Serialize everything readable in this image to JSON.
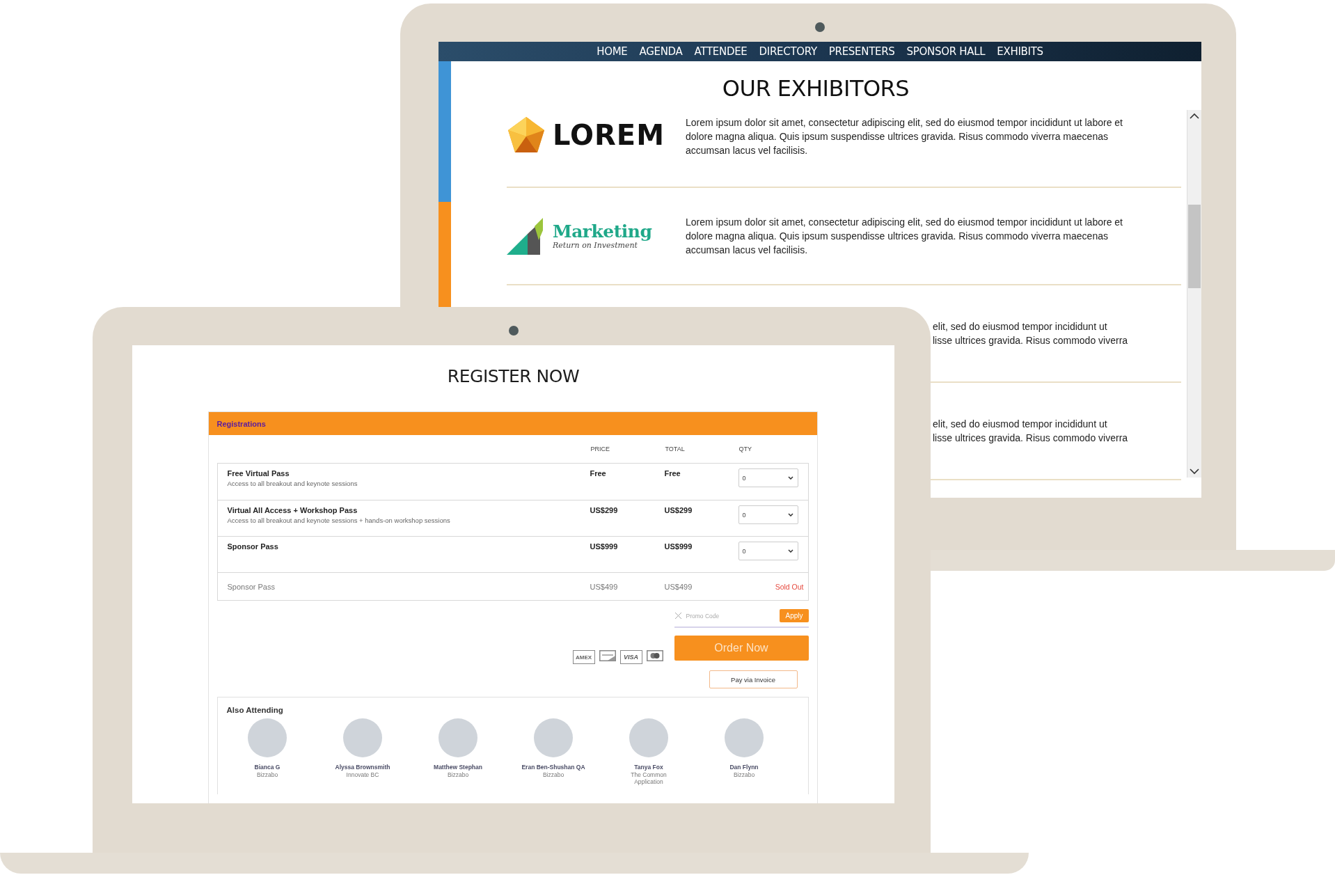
{
  "exhibits_screen": {
    "nav": [
      "HOME",
      "AGENDA",
      "ATTENDEE",
      "DIRECTORY",
      "PRESENTERS",
      "SPONSOR HALL",
      "EXHIBITS"
    ],
    "title": "OUR EXHIBITORS",
    "exhibitors": [
      {
        "kind": "full",
        "logo": {
          "kind": "pentagon",
          "title": "LOREM"
        },
        "description": "Lorem ipsum dolor sit amet, consectetur adipiscing elit, sed do eiusmod tempor incididunt ut labore et dolore magna aliqua. Quis ipsum suspendisse ultrices gravida. Risus commodo viverra maecenas accumsan lacus vel facilisis."
      },
      {
        "kind": "full",
        "logo": {
          "kind": "chart",
          "title": "Marketing",
          "subtitle": "Return on Investment"
        },
        "description": "Lorem ipsum dolor sit amet, consectetur adipiscing elit, sed do eiusmod tempor incididunt ut labore et dolore magna aliqua. Quis ipsum suspendisse ultrices gravida. Risus commodo viverra maecenas accumsan lacus vel facilisis."
      },
      {
        "kind": "partial",
        "lines": [
          "elit, sed do eiusmod tempor incididunt ut",
          "lisse ultrices gravida. Risus commodo viverra"
        ]
      },
      {
        "kind": "partial",
        "lines": [
          "elit, sed do eiusmod tempor incididunt ut",
          "lisse ultrices gravida. Risus commodo viverra"
        ]
      }
    ]
  },
  "register_screen": {
    "title": "REGISTER NOW",
    "panel_title": "Registrations",
    "columns": [
      "PRICE",
      "TOTAL",
      "QTY"
    ],
    "tickets": [
      {
        "kind": "available",
        "name": "Free Virtual Pass",
        "description": "Access to all breakout and keynote sessions",
        "price": "Free",
        "total": "Free",
        "qty": "0"
      },
      {
        "kind": "available",
        "name": "Virtual All Access + Workshop Pass",
        "description": "Access to all breakout and keynote sessions + hands-on workshop sessions",
        "price": "US$299",
        "total": "US$299",
        "qty": "0"
      },
      {
        "kind": "available",
        "name": "Sponsor Pass",
        "price": "US$999",
        "total": "US$999",
        "qty": "0"
      },
      {
        "kind": "sold_out",
        "name": "Sponsor Pass",
        "price": "US$499",
        "total": "US$499",
        "status": "Sold Out"
      }
    ],
    "promo": {
      "placeholder": "Promo Code",
      "apply": "Apply"
    },
    "cards": [
      {
        "kind": "amex",
        "label": "AMEX"
      },
      {
        "kind": "discover"
      },
      {
        "kind": "visa",
        "label": "VISA"
      },
      {
        "kind": "mastercard"
      }
    ],
    "order_button": "Order Now",
    "invoice_button": "Pay via Invoice",
    "attending": {
      "title": "Also Attending",
      "people": [
        {
          "name": "Bianca G",
          "company": "Bizzabo"
        },
        {
          "name": "Alyssa Brownsmith",
          "company": "Innovate BC"
        },
        {
          "name": "Matthew Stephan",
          "company": "Bizzabo"
        },
        {
          "name": "Eran Ben-Shushan QA",
          "company": "Bizzabo"
        },
        {
          "name": "Tanya Fox",
          "company": "The Common Application"
        },
        {
          "name": "Dan Flynn",
          "company": "Bizzabo"
        }
      ]
    }
  }
}
